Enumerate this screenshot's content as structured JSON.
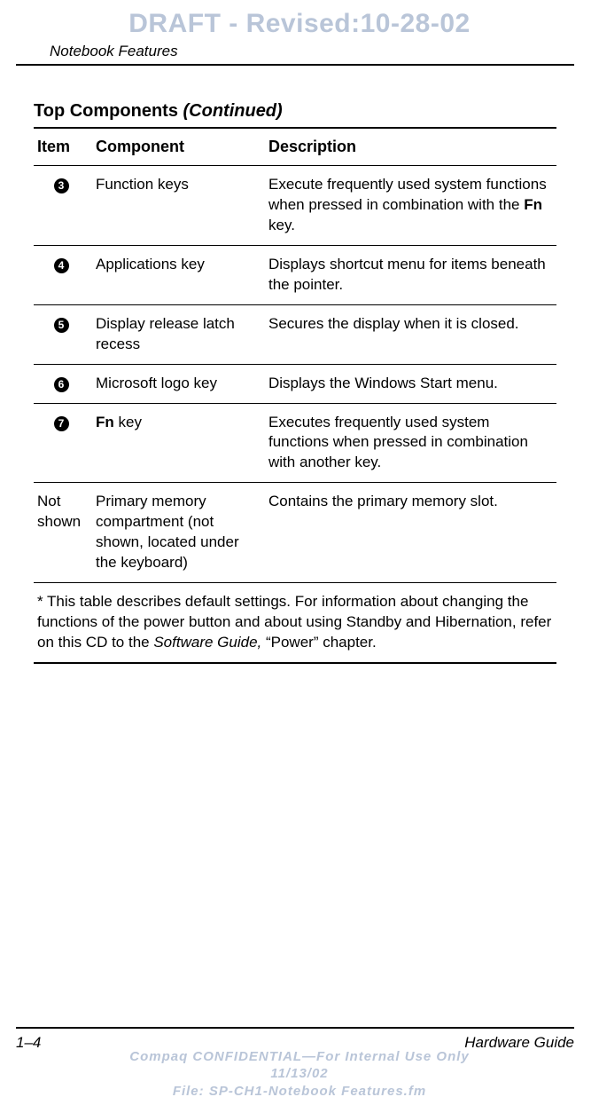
{
  "watermark_top": "DRAFT - Revised:10-28-02",
  "header": "Notebook Features",
  "table": {
    "title_main": "Top Components ",
    "title_cont": "(Continued)",
    "columns": {
      "c0": "Item",
      "c1": "Component",
      "c2": "Description"
    },
    "rows": [
      {
        "item_num": "3",
        "component": "Function keys",
        "desc_pre": "Execute frequently used system functions when pressed in combination with the ",
        "desc_bold": "Fn",
        "desc_post": " key."
      },
      {
        "item_num": "4",
        "component": "Applications key",
        "desc_pre": "Displays shortcut menu for items beneath the pointer.",
        "desc_bold": "",
        "desc_post": ""
      },
      {
        "item_num": "5",
        "component": "Display release latch recess",
        "desc_pre": "Secures the display when it is closed.",
        "desc_bold": "",
        "desc_post": ""
      },
      {
        "item_num": "6",
        "component": "Microsoft logo key",
        "desc_pre": "Displays the Windows Start menu.",
        "desc_bold": "",
        "desc_post": ""
      },
      {
        "item_num": "7",
        "component_bold": "Fn",
        "component_post": " key",
        "desc_pre": "Executes frequently used system functions when pressed in combination with another key.",
        "desc_bold": "",
        "desc_post": ""
      },
      {
        "item_text": "Not shown",
        "component": "Primary memory compartment (not shown, located under the keyboard)",
        "desc_pre": "Contains the primary memory slot.",
        "desc_bold": "",
        "desc_post": ""
      }
    ],
    "footnote_pre": "* This table describes default settings. For information about changing the functions of the power button and about using Standby and Hibernation, refer on this CD to the ",
    "footnote_em": "Software Guide,",
    "footnote_post": " “Power” chapter."
  },
  "footer": {
    "left": "1–4",
    "right": "Hardware Guide"
  },
  "watermark_bottom": {
    "line1": "Compaq CONFIDENTIAL—For Internal Use Only",
    "line2": "11/13/02",
    "line3": "File: SP-CH1-Notebook Features.fm"
  }
}
